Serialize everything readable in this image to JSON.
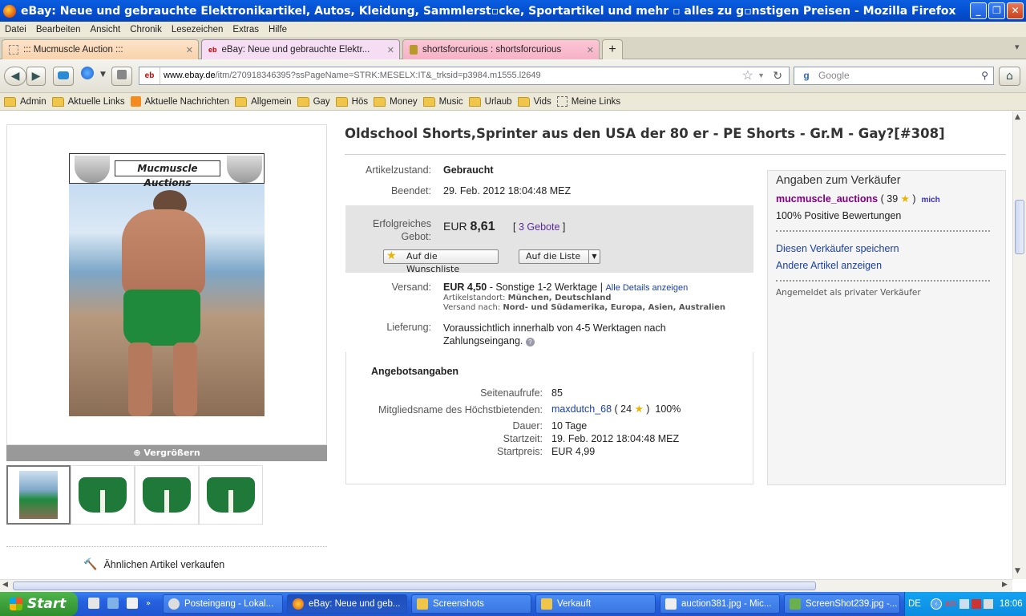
{
  "window": {
    "title": "eBay: Neue und gebrauchte Elektronikartikel, Autos, Kleidung, Sammlerst▫cke, Sportartikel und mehr ▫ alles zu g▫nstigen Preisen - Mozilla Firefox",
    "btn_min": "_",
    "btn_max": "❐",
    "btn_close": "✕"
  },
  "menu": [
    "Datei",
    "Bearbeiten",
    "Ansicht",
    "Chronik",
    "Lesezeichen",
    "Extras",
    "Hilfe"
  ],
  "tabs": [
    {
      "label": "::: Mucmuscle Auction :::"
    },
    {
      "label": "eBay: Neue und gebrauchte Elektr..."
    },
    {
      "label": "shortsforcurious : shortsforcurious"
    }
  ],
  "tab_add": "+",
  "tab_list": "▾",
  "nav": {
    "back": "◀",
    "forward": "▶",
    "url_site": "eb",
    "url_domain": "www.ebay.de",
    "url_path": "/itm/270918346395?ssPageName=STRK:MESELX:IT&_trksid=p3984.m1555.l2649",
    "star": "☆",
    "reload": "↻",
    "search_engine": "g",
    "search_placeholder": "Google",
    "home": "⌂"
  },
  "bookmarks": [
    {
      "label": "Admin",
      "icon": "folder-icon"
    },
    {
      "label": "Aktuelle Links",
      "icon": "folder-icon"
    },
    {
      "label": "Aktuelle Nachrichten",
      "icon": "rss-icon"
    },
    {
      "label": "Allgemein",
      "icon": "folder-icon"
    },
    {
      "label": "Gay",
      "icon": "folder-icon"
    },
    {
      "label": "Hös",
      "icon": "folder-icon"
    },
    {
      "label": "Money",
      "icon": "folder-icon"
    },
    {
      "label": "Music",
      "icon": "folder-icon"
    },
    {
      "label": "Urlaub",
      "icon": "folder-icon"
    },
    {
      "label": "Vids",
      "icon": "folder-icon"
    },
    {
      "label": "Meine Links",
      "icon": "dashed-folder-icon"
    }
  ],
  "item": {
    "title": "Oldschool Shorts,Sprinter aus den USA der 80 er - PE Shorts - Gr.M - Gay?[#308]",
    "image_banner": "Mucmuscle Auctions",
    "enlarge": "Vergrößern",
    "sell_similar": "Ähnlichen Artikel verkaufen",
    "condition_label": "Artikelzustand:",
    "condition_value": "Gebraucht",
    "ended_label": "Beendet:",
    "ended_value": "29. Feb. 2012 18:04:48 MEZ",
    "bid_label_1": "Erfolgreiches",
    "bid_label_2": "Gebot:",
    "bid_currency": "EUR",
    "bid_amount": "8,61",
    "bids_link": "3 Gebote",
    "bracket_open": "[",
    "bracket_close": "]",
    "watchlist_btn": "Auf die Wunschliste",
    "list_btn": "Auf die Liste",
    "shipping_label": "Versand:",
    "shipping_price": "EUR 4,50",
    "shipping_desc": "- Sonstige 1-2 Werktage",
    "shipping_sep": "|",
    "shipping_details": "Alle Details anzeigen",
    "location_label": "Artikelstandort:",
    "location_value": "München, Deutschland",
    "ships_to_label": "Versand nach:",
    "ships_to_value": "Nord- und Südamerika, Europa, Asien, Australien",
    "delivery_label": "Lieferung:",
    "delivery_line1": "Voraussichtlich innerhalb von 4-5 Werktagen nach",
    "delivery_line2": "Zahlungseingang.",
    "offer_heading": "Angebotsangaben",
    "views_label": "Seitenaufrufe:",
    "views_value": "85",
    "top_bidder_label": "Mitgliedsname des Höchstbietenden:",
    "top_bidder_name": "maxdutch_68",
    "top_bidder_score": "24",
    "top_bidder_pct": "100%",
    "duration_label": "Dauer:",
    "duration_value": "10 Tage",
    "start_time_label": "Startzeit:",
    "start_time_value": "19. Feb. 2012 18:04:48 MEZ",
    "start_price_label": "Startpreis:",
    "start_price_value": "EUR 4,99"
  },
  "seller": {
    "heading": "Angaben zum Verkäufer",
    "name": "mucmuscle_auctions",
    "score": "39",
    "me_badge": "mich",
    "feedback": "100% Positive Bewertungen",
    "save_seller": "Diesen Verkäufer speichern",
    "other_items": "Andere Artikel anzeigen",
    "private_note": "Angemeldet als privater Verkäufer"
  },
  "taskbar": {
    "start": "Start",
    "tasks": [
      {
        "label": "Posteingang - Lokal...",
        "active": false
      },
      {
        "label": "eBay: Neue und geb...",
        "active": true
      },
      {
        "label": "Screenshots",
        "active": false
      },
      {
        "label": "Verkauft",
        "active": false
      },
      {
        "label": "auction381.jpg - Mic...",
        "active": false
      },
      {
        "label": "ScreenShot239.jpg -...",
        "active": false
      }
    ],
    "lang": "DE",
    "clock": "18:06"
  },
  "colors": {
    "title_blue": "#0550d2",
    "ebay_link": "#1a3fa3",
    "seller_purple": "#800080",
    "bid_box": "#e4e4e4",
    "shorts_green": "#1f7a3a"
  }
}
